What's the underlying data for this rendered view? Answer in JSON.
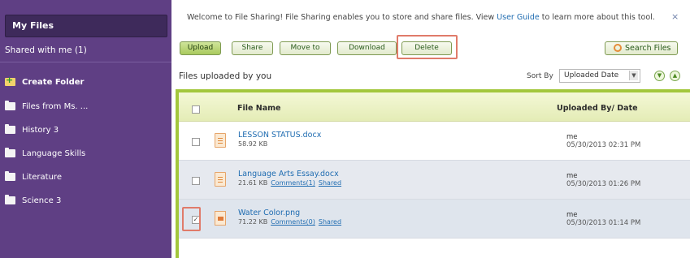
{
  "sidebar": {
    "my_files": "My Files",
    "shared_with_me": "Shared with me (1)",
    "items": [
      {
        "label": "Create Folder",
        "icon": "create-folder-icon"
      },
      {
        "label": "Files from Ms. ...",
        "icon": "folder-icon"
      },
      {
        "label": "History 3",
        "icon": "folder-icon"
      },
      {
        "label": "Language Skills",
        "icon": "folder-icon"
      },
      {
        "label": "Literature",
        "icon": "folder-icon"
      },
      {
        "label": "Science 3",
        "icon": "folder-icon"
      }
    ]
  },
  "welcome": {
    "text_before": "Welcome to File Sharing! File Sharing enables you to store and share files. View ",
    "link": "User Guide",
    "text_after": " to learn more about this tool.",
    "close": "×"
  },
  "toolbar": {
    "upload": "Upload",
    "share": "Share",
    "move_to": "Move to",
    "download": "Download",
    "delete": "Delete",
    "search": "Search Files"
  },
  "files_heading": "Files uploaded by you",
  "sort": {
    "label": "Sort By",
    "selected": "Uploaded Date",
    "down": "▼",
    "up": "▲"
  },
  "table": {
    "headers": {
      "name": "File Name",
      "uploaded": "Uploaded By/ Date"
    },
    "rows": [
      {
        "name": "LESSON STATUS.docx",
        "size": "58.92 KB",
        "comments": "",
        "shared": "",
        "uploader": "me",
        "date": "05/30/2013 02:31 PM",
        "checked": ""
      },
      {
        "name": "Language Arts Essay.docx",
        "size": "21.61 KB",
        "comments": "Comments(1)",
        "shared": "Shared",
        "uploader": "me",
        "date": "05/30/2013 01:26 PM",
        "checked": ""
      },
      {
        "name": "Water Color.png",
        "size": "71.22 KB",
        "comments": "Comments(0)",
        "shared": "Shared",
        "uploader": "me",
        "date": "05/30/2013 01:14 PM",
        "checked": "✓"
      }
    ]
  },
  "colors": {
    "sidebar": "#5f3f84",
    "accent_green": "#a3c73d",
    "highlight": "#e07b6a",
    "link": "#1f6cb1"
  }
}
